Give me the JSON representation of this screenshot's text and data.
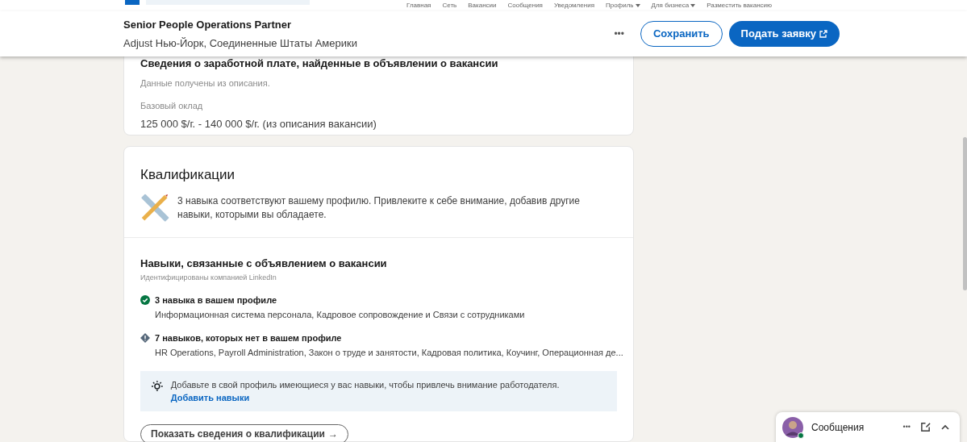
{
  "top_nav": {
    "items": [
      {
        "label": "Главная",
        "dropdown": false
      },
      {
        "label": "Сеть",
        "dropdown": false
      },
      {
        "label": "Вакансии",
        "dropdown": false
      },
      {
        "label": "Сообщения",
        "dropdown": false
      },
      {
        "label": "Уведомления",
        "dropdown": false
      },
      {
        "label": "Профиль",
        "dropdown": true
      },
      {
        "label": "Для бизнеса",
        "dropdown": true
      },
      {
        "label": "Разместить вакансию",
        "dropdown": false
      }
    ]
  },
  "job_bar": {
    "title": "Senior People Operations Partner",
    "subtitle": "Adjust Нью-Йорк, Соединенные Штаты Америки",
    "more": "•••",
    "save_button": "Сохранить",
    "apply_button": "Подать заявку"
  },
  "salary_card": {
    "title": "Сведения о заработной плате, найденные в объявлении о вакансии",
    "note": "Данные получены из описания.",
    "label": "Базовый оклад",
    "value": "125 000 $/г. - 140 000 $/г. (из описания вакансии)"
  },
  "qualifications": {
    "title": "Квалификации",
    "summary": "3 навыка соответствуют вашему профилю. Привлеките к себе внимание, добавив другие навыки, которыми вы обладаете.",
    "skills_title": "Навыки, связанные с объявлением о вакансии",
    "skills_note": "Идентифицированы компанией LinkedIn",
    "groups": [
      {
        "kind": "match",
        "title": "3 навыка в вашем профиле",
        "skills": "Информационная система персонала, Кадровое сопровождение и Связи с сотрудниками"
      },
      {
        "kind": "missing",
        "title": "7 навыков, которых нет в вашем профиле",
        "skills": "HR Operations, Payroll Administration, Закон о труде и занятости, Кадровая политика, Коучинг, Операционная де..."
      }
    ],
    "tip": "Добавьте в свой профиль имеющиеся у вас навыки, чтобы привлечь внимание работодателя.",
    "tip_link": "Добавить навыки",
    "show_button": "Показать сведения о квалификации",
    "show_arrow": "→"
  },
  "messaging": {
    "label": "Сообщения",
    "online": true,
    "more": "•••"
  }
}
